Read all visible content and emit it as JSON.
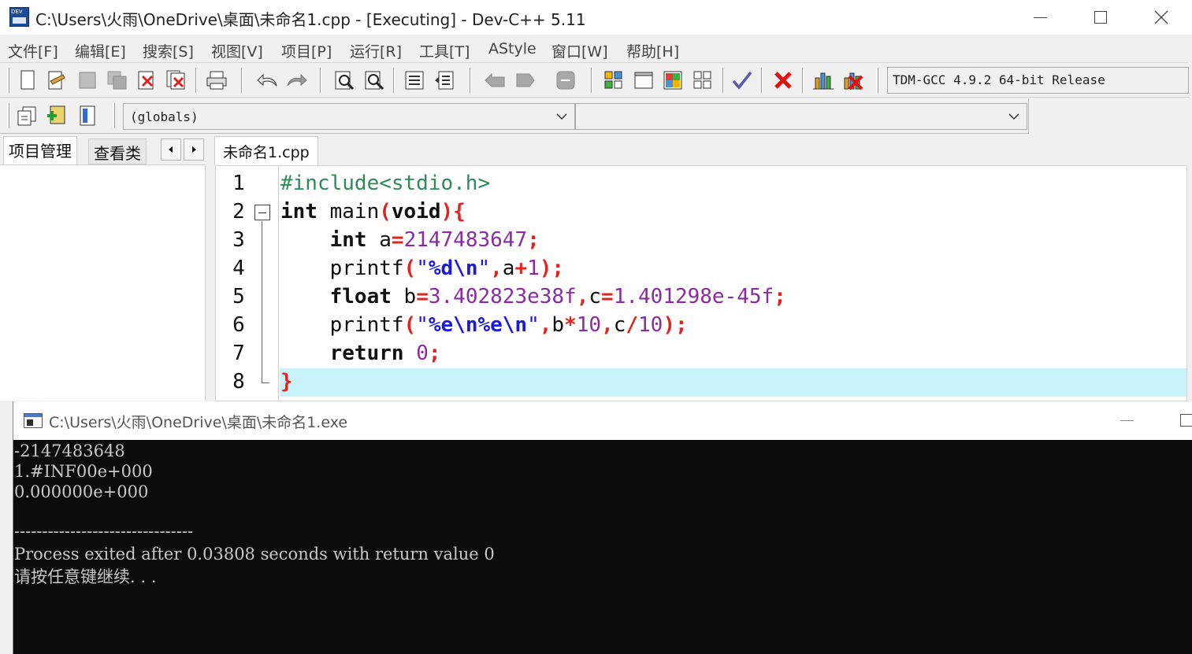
{
  "window": {
    "title": "C:\\Users\\火雨\\OneDrive\\桌面\\未命名1.cpp - [Executing] - Dev-C++ 5.11",
    "logo_text": "DEV"
  },
  "menu": [
    "文件[F]",
    "编辑[E]",
    "搜索[S]",
    "视图[V]",
    "项目[P]",
    "运行[R]",
    "工具[T]",
    "AStyle",
    "窗口[W]",
    "帮助[H]"
  ],
  "toolbar": {
    "compiler": "TDM-GCC 4.9.2 64-bit Release",
    "globals_combo": "(globals)",
    "members_combo": ""
  },
  "left_panel": {
    "tabs": [
      "项目管理",
      "查看类"
    ],
    "active_tab": "项目管理"
  },
  "editor": {
    "tab": "未命名1.cpp",
    "current_line": 8,
    "line_numbers": [
      "1",
      "2",
      "3",
      "4",
      "5",
      "6",
      "7",
      "8"
    ],
    "lines": [
      "#include<stdio.h>",
      "int main(void){",
      "    int a=2147483647;",
      "    printf(\"%d\\n\",a+1);",
      "    float b=3.402823e38f,c=1.401298e-45f;",
      "    printf(\"%e\\n%e\\n\",b*10,c/10);",
      "    return 0;",
      "}"
    ]
  },
  "console": {
    "title": "C:\\Users\\火雨\\OneDrive\\桌面\\未命名1.exe",
    "output": [
      "-2147483648",
      "1.#INF00e+000",
      "0.000000e+000",
      "",
      "--------------------------------",
      "Process exited after 0.03808 seconds with return value 0",
      "请按任意键继续. . ."
    ]
  },
  "colors": {
    "highlight_line": "#c9f3fa",
    "preprocessor": "#2e8b57",
    "symbol": "#e0241f",
    "number": "#8a2ba0",
    "string": "#1a1adf",
    "console_bg": "#0c0c0c",
    "console_text": "#c8c8c8"
  },
  "icons": [
    "new-file-icon",
    "open-file-icon",
    "save-icon",
    "save-all-icon",
    "close-icon",
    "close-all-icon",
    "print-icon",
    "undo-icon",
    "redo-icon",
    "find-icon",
    "replace-icon",
    "indent-icon",
    "unindent-icon",
    "goto-back-icon",
    "goto-forward-icon",
    "bookmark-icon",
    "new-project-icon",
    "add-to-project-icon",
    "remove-from-project-icon",
    "project-options-icon",
    "compile-icon",
    "stop-icon",
    "profile-icon",
    "delete-profile-icon",
    "new-class-icon",
    "insert-icon",
    "toggle-icon"
  ]
}
